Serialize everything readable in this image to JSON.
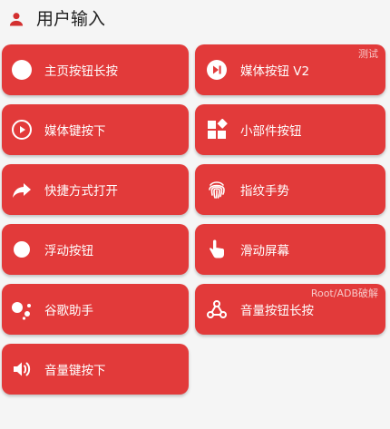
{
  "header": {
    "title": "用户输入",
    "icon": "person-icon"
  },
  "cards": {
    "home_long_press": {
      "label": "主页按钮长按",
      "icon": "circle-icon"
    },
    "media_button_v2": {
      "label": "媒体按钮 V2",
      "icon": "skip-next-icon",
      "tag": "测试"
    },
    "media_key_down": {
      "label": "媒体键按下",
      "icon": "play-circle-icon"
    },
    "widget_button": {
      "label": "小部件按钮",
      "icon": "widgets-icon"
    },
    "shortcut_open": {
      "label": "快捷方式打开",
      "icon": "share-arrow-icon"
    },
    "fingerprint_gesture": {
      "label": "指纹手势",
      "icon": "fingerprint-icon"
    },
    "floating_button": {
      "label": "浮动按钮",
      "icon": "circle-icon"
    },
    "swipe_screen": {
      "label": "滑动屏幕",
      "icon": "touch-hand-icon"
    },
    "google_assistant": {
      "label": "谷歌助手",
      "icon": "assistant-icon"
    },
    "volume_long_press": {
      "label": "音量按钮长按",
      "icon": "webhook-icon",
      "tag": "Root/ADB破解"
    },
    "volume_key_down": {
      "label": "音量键按下",
      "icon": "volume-icon"
    }
  },
  "colors": {
    "card_background": "#e23a3a",
    "icon_accent": "#d32f2f",
    "page_background": "#f5f5f5"
  }
}
